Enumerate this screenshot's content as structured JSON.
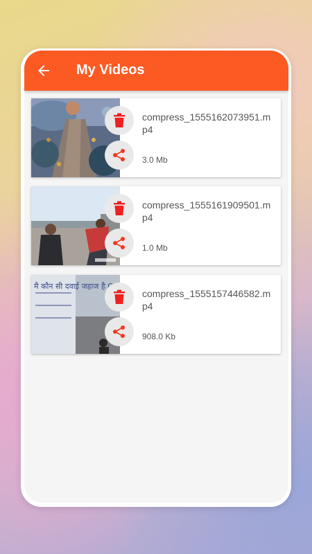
{
  "appbar": {
    "title": "My Videos",
    "back_icon": "arrow-back-icon"
  },
  "colors": {
    "accent": "#fc5a23",
    "delete_red": "#f02020",
    "share_red": "#f03a1e"
  },
  "videos": [
    {
      "filename": "compress_1555162073951.mp4",
      "size": "3.0 Mb"
    },
    {
      "filename": "compress_1555161909501.mp4",
      "size": "1.0 Mb"
    },
    {
      "filename": "compress_1555157446582.mp4",
      "size": "908.0 Kb"
    }
  ],
  "thumb3_text": "मै कौन सी दवाई जहाज है OMG"
}
